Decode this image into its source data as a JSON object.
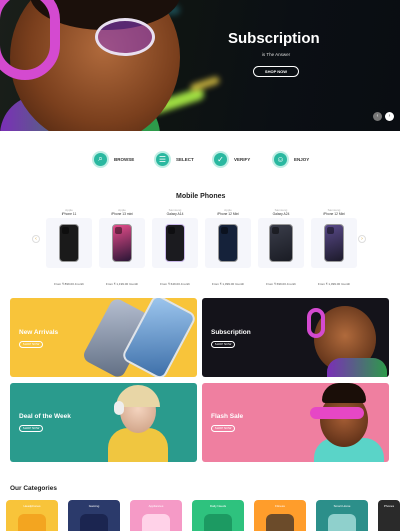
{
  "hero": {
    "title": "Subscription",
    "subtitle": "is The Answer",
    "button_label": "SHOP NOW",
    "prev_icon": "‹",
    "next_icon": "›"
  },
  "steps": [
    {
      "label": "BROWSE",
      "icon": "search-icon",
      "glyph": "⌕"
    },
    {
      "label": "SELECT",
      "icon": "list-icon",
      "glyph": "☰"
    },
    {
      "label": "VERIFY",
      "icon": "check-icon",
      "glyph": "✓"
    },
    {
      "label": "ENJOY",
      "icon": "smile-icon",
      "glyph": "☺"
    }
  ],
  "mobile_phones": {
    "title": "Mobile Phones",
    "prev_icon": "‹",
    "next_icon": "›",
    "products": [
      {
        "brand": "Apple",
        "name": "iPhone 11",
        "price": "From ₹ 899.00 /month",
        "color": "#222",
        "screen": "#1a1a1a"
      },
      {
        "brand": "Apple",
        "name": "iPhone 13 mini",
        "price": "From ₹ 1,199.00 /month",
        "color": "#e64d8b",
        "screen": "#2a1636"
      },
      {
        "brand": "Samsung",
        "name": "Galaxy A14",
        "price": "From ₹ 649.00 /month",
        "color": "#c9b8e8",
        "screen": "#1b1b1f"
      },
      {
        "brand": "Apple",
        "name": "iPhone 12 Mini",
        "price": "From ₹ 1,099.00 /month",
        "color": "#1b1e2c",
        "screen": "#15223a"
      },
      {
        "brand": "Samsung",
        "name": "Galaxy A24",
        "price": "From ₹ 699.00 /month",
        "color": "#2d2d2d",
        "screen": "#23262e"
      },
      {
        "brand": "Samsung",
        "name": "iPhone 12 Mini",
        "price": "From ₹ 1,099.00 /month",
        "color": "#222",
        "screen": "#302a48"
      }
    ]
  },
  "promos": [
    {
      "title": "New Arrivals",
      "button": "SHOP NOW"
    },
    {
      "title": "Subscription",
      "button": "SHOP NOW"
    },
    {
      "title": "Deal of the Week",
      "button": "SHOP NOW"
    },
    {
      "title": "Flash Sale",
      "button": "SHOP NOW"
    }
  ],
  "categories": {
    "title": "Our Categories",
    "items": [
      {
        "label": "Headphones",
        "color": "#f8c43a",
        "obj": "#f3a520"
      },
      {
        "label": "Gaming",
        "color": "#2b3a6b",
        "obj": "#1b2550"
      },
      {
        "label": "Appliances",
        "color": "#f59ac6",
        "obj": "#ffd2e8"
      },
      {
        "label": "Daily Needs",
        "color": "#2ec27e",
        "obj": "#1c9a62"
      },
      {
        "label": "Fitness",
        "color": "#ff9d2b",
        "obj": "#6b4b2a"
      },
      {
        "label": "Smart Home",
        "color": "#2c8f8a",
        "obj": "#8fd0cc"
      },
      {
        "label": "Phones",
        "color": "#2a2a2a",
        "obj": "#555"
      }
    ]
  }
}
